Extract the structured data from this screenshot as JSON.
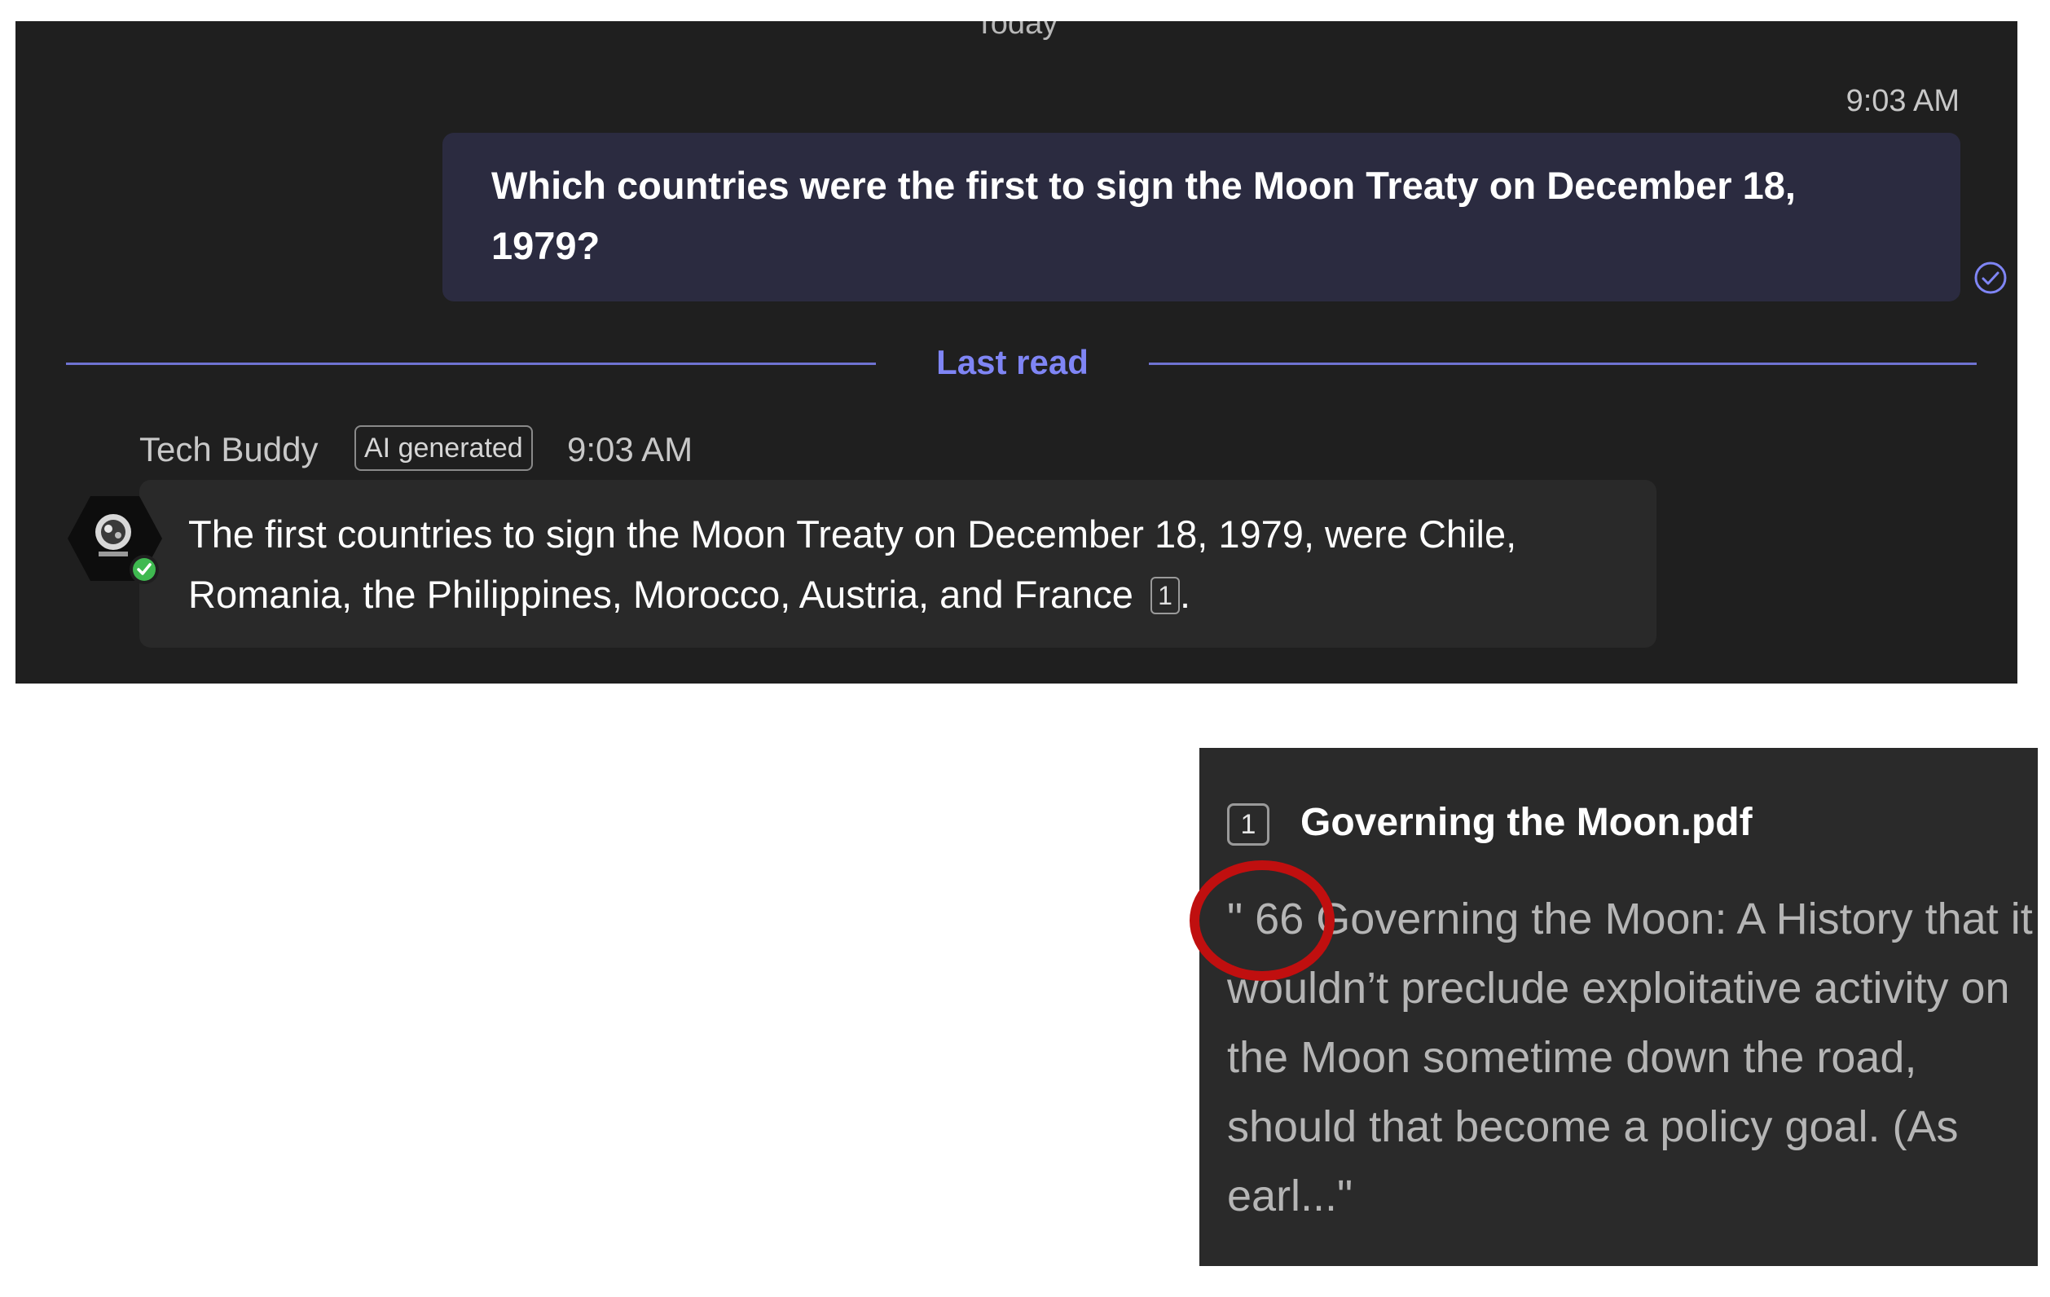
{
  "chat": {
    "day_label": "Today",
    "sent": {
      "time": "9:03 AM",
      "text": "Which countries were the first to sign the Moon Treaty on December 18, 1979?"
    },
    "last_read_label": "Last read",
    "received": {
      "sender": "Tech Buddy",
      "badge": "AI generated",
      "time": "9:03 AM",
      "text": "The first countries to sign the Moon Treaty on December 18, 1979, were Chile, Romania, the Philippines, Morocco, Austria, and France",
      "citation_number": "1",
      "trailing": "."
    }
  },
  "citation": {
    "number": "1",
    "title": "Governing the Moon.pdf",
    "excerpt": "\" 66 Governing the Moon: A History that it wouldn’t preclude exploitative activity on the Moon sometime down the road, should that become a policy goal. (As earl...\""
  },
  "colors": {
    "panel_bg": "#1f1f1f",
    "sent_bubble": "#2b2b40",
    "received_bubble": "#292929",
    "accent": "#7f85f5",
    "highlight": "#c00f0f"
  },
  "icons": [
    "read-receipt-icon",
    "bot-avatar-icon",
    "available-status-icon"
  ]
}
